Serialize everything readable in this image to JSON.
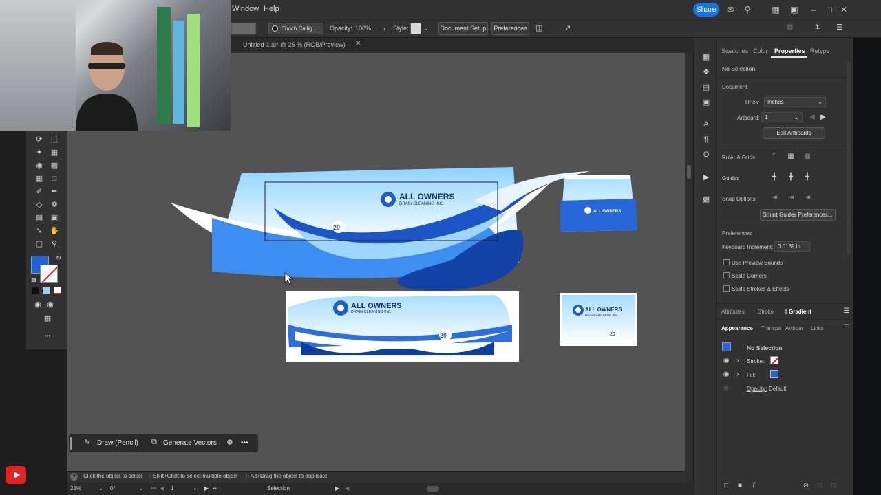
{
  "menu": {
    "window": "Window",
    "help": "Help",
    "share": "Share"
  },
  "controlbar": {
    "brush": "Touch Callig...",
    "opacity_label": "Opacity:",
    "opacity_value": "100%",
    "style_label": "Style:",
    "document_setup": "Document Setup",
    "preferences": "Preferences"
  },
  "document": {
    "tab_title": "Untitled-1.ai* @ 25 % (RGB/Preview)"
  },
  "artwork": {
    "brand_name": "ALL OWNERS",
    "brand_tagline": "DRAIN CLEANING INC.",
    "badge": "20"
  },
  "contextbar": {
    "draw": "Draw (Pencil)",
    "generate": "Generate Vectors",
    "more": "•••"
  },
  "hints": {
    "click": "Click the object to select",
    "shift": "Shift+Click to select multiple object",
    "alt": "Alt+Drag the object to duplicate"
  },
  "statusbar": {
    "zoom": "25%",
    "rotation": "0°",
    "artboard": "1",
    "tool": "Selection"
  },
  "panel": {
    "tabs": [
      "Swatches",
      "Color",
      "Properties",
      "Retype"
    ],
    "no_selection": "No Selection",
    "document": "Document",
    "units_label": "Units:",
    "units_value": "Inches",
    "artboard_label": "Artboard:",
    "artboard_value": "1",
    "edit_artboards": "Edit Artboards",
    "ruler_grids": "Ruler & Grids",
    "guides": "Guides",
    "snap_options": "Snap Options",
    "smart_guides": "Smart Guides Preferences...",
    "preferences": "Preferences",
    "keyboard_increment_label": "Keyboard Increment:",
    "keyboard_increment_value": "0.0139 in",
    "use_preview_bounds": "Use Preview Bounds",
    "scale_corners": "Scale Corners",
    "scale_strokes": "Scale Strokes & Effects",
    "tabs2": [
      "Attributes",
      "Stroke",
      "Gradient"
    ],
    "tabs3": [
      "Appearance",
      "Transpa",
      "Artboar",
      "Links"
    ],
    "app_no_selection": "No Selection",
    "stroke_label": "Stroke:",
    "fill_label": "Fill:",
    "opacity_label": "Opacity:",
    "opacity_value": "Default"
  },
  "colors": {
    "accent": "#1473e6",
    "fill": "#1f63d8",
    "canvas": "#535353",
    "brand_blue": "#1f5fc4"
  }
}
